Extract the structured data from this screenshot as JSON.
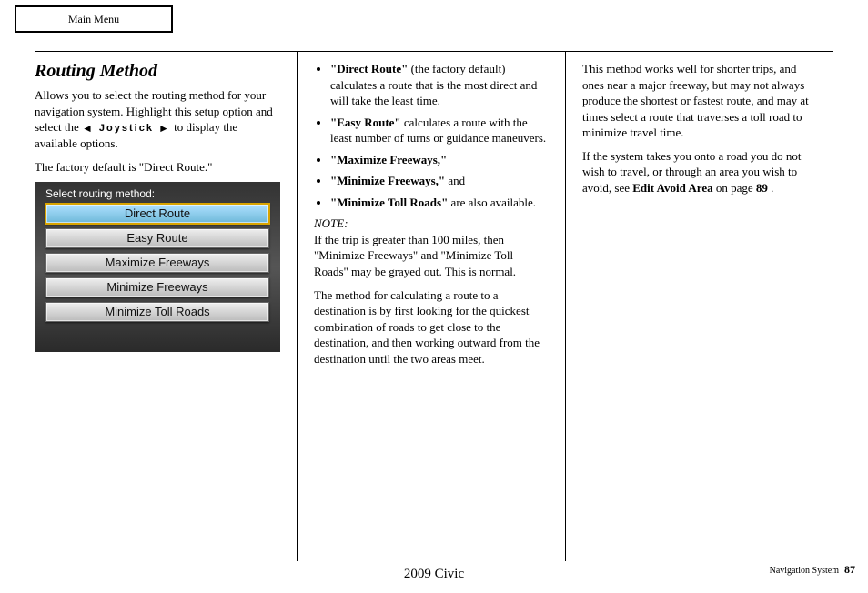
{
  "header": {
    "mainMenu": "Main Menu"
  },
  "col1": {
    "title": "Routing Method",
    "para1a": "Allows you to select the routing method for your navigation system. Highlight this setup option and select the ",
    "joystickWord": " Joystick ",
    "para1b": " to display the available options.",
    "para2": "The factory default is \"Direct Route.\""
  },
  "screen": {
    "title": "Select routing method:",
    "options": [
      "Direct Route",
      "Easy Route",
      "Maximize Freeways",
      "Minimize Freeways",
      "Minimize Toll Roads"
    ]
  },
  "col2": {
    "items": [
      {
        "name": "\"Direct Route\"",
        "desc": "(the factory default) calculates a route that is the most direct and will take the least time."
      },
      {
        "name": "\"Easy Route\"",
        "desc": "calculates a route with the least number of turns or guidance maneuvers."
      },
      {
        "name": "\"Maximize Freeways,\"",
        "desc": ""
      },
      {
        "name": "\"Minimize Freeways,\"",
        "desc": "and"
      },
      {
        "name": "\"Minimize Toll Roads\"",
        "desc": "are also available."
      }
    ],
    "noteTitle": "NOTE:",
    "note1": "If the trip is greater than 100 miles, then \"Minimize Freeways\" and \"Minimize Toll Roads\" may be grayed out. This is normal.",
    "note2": "The method for calculating a route to a destination is by first looking for the quickest combination of roads to get close to the destination, and then working outward from the destination until the two areas meet."
  },
  "col3": {
    "para1": "This method works well for shorter trips, and ones near a major freeway, but may not always produce the shortest or fastest route, and may at times select a route that traverses a toll road to minimize travel time.",
    "para2a": "If the system takes you onto a road you do not wish to travel, or through an area you wish to avoid, see ",
    "bold1": "Edit Avoid Area",
    "para2b": " on page ",
    "bold2": "89",
    "para2c": "."
  },
  "footer": {
    "model": "2009  Civic",
    "pageLabel": "Navigation System",
    "pageNumber": "87"
  }
}
